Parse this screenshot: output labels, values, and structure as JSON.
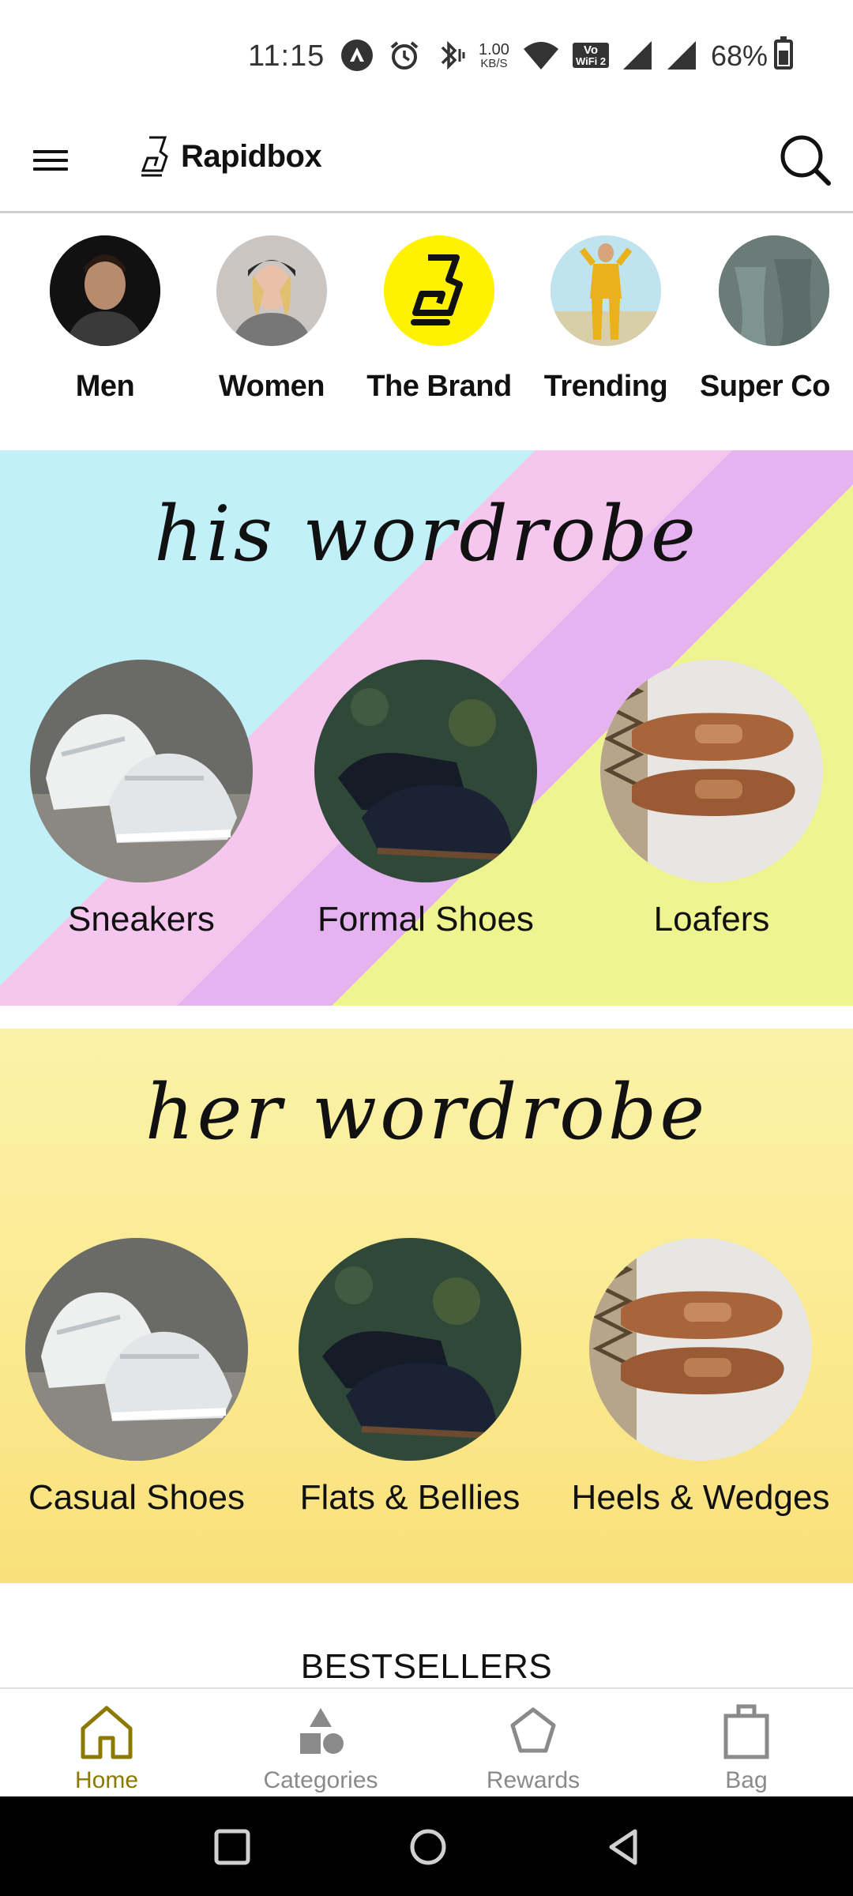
{
  "status_bar": {
    "time": "11:15",
    "net_speed_value": "1.00",
    "net_speed_unit": "KB/S",
    "volte_line1": "Vo",
    "volte_line2": "WiFi 2",
    "battery": "68%"
  },
  "header": {
    "brand": "Rapidbox"
  },
  "categories": [
    {
      "label": "Men"
    },
    {
      "label": "Women"
    },
    {
      "label": "The Brand"
    },
    {
      "label": "Trending"
    },
    {
      "label": "Super Co"
    }
  ],
  "his_wardrobe": {
    "title": "his wordrobe",
    "items": [
      {
        "label": "Sneakers"
      },
      {
        "label": "Formal Shoes"
      },
      {
        "label": "Loafers"
      }
    ]
  },
  "her_wardrobe": {
    "title": "her wordrobe",
    "items": [
      {
        "label": "Casual Shoes"
      },
      {
        "label": "Flats & Bellies"
      },
      {
        "label": "Heels & Wedges"
      }
    ]
  },
  "bestsellers": {
    "title": "BESTSELLERS"
  },
  "bottom_nav": [
    {
      "label": "Home",
      "icon": "home-icon",
      "active": true
    },
    {
      "label": "Categories",
      "icon": "categories-icon",
      "active": false
    },
    {
      "label": "Rewards",
      "icon": "rewards-icon",
      "active": false
    },
    {
      "label": "Bag",
      "icon": "bag-icon",
      "active": false
    }
  ],
  "colors": {
    "accent": "#8c7a00",
    "brand_yellow": "#fff200",
    "his_bg_cyan": "#c1f0f9",
    "his_bg_pink": "#f5c7ef",
    "his_bg_lilac": "#e6b3f1",
    "his_bg_lime": "#eef48f",
    "her_bg_yellow": "#fbe98e"
  }
}
